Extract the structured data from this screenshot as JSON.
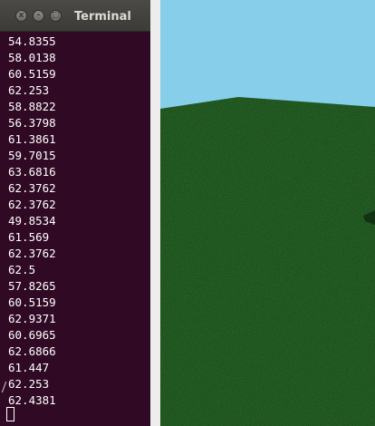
{
  "terminal": {
    "title": "Terminal",
    "buttons": {
      "close": "x",
      "minimize": "-",
      "maximize": "□"
    },
    "output_lines": [
      "54.8355",
      "58.0138",
      "60.5159",
      "62.253",
      "58.8822",
      "56.3798",
      "61.3861",
      "59.7015",
      "63.6816",
      "62.3762",
      "62.3762",
      "49.8534",
      "61.569",
      "62.3762",
      "62.5",
      "57.8265",
      "60.5159",
      "62.9371",
      "60.6965",
      "62.6866",
      "61.447",
      "62.253",
      "62.4381"
    ],
    "colors": {
      "background": "#300a24",
      "text": "#ffffff",
      "titlebar": "#3c3b37"
    }
  },
  "viewport": {
    "colors": {
      "sky": "#87ceeb",
      "ground": "#1e4a1e",
      "ground_dark": "#123212"
    }
  }
}
